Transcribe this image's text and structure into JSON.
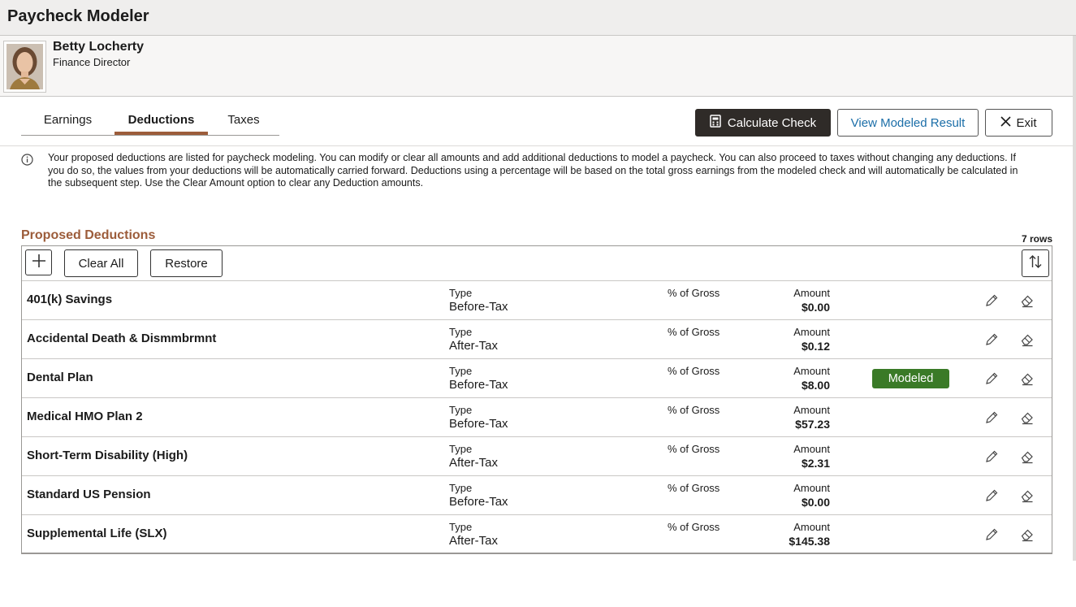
{
  "app": {
    "title": "Paycheck Modeler"
  },
  "employee": {
    "name": "Betty Locherty",
    "title": "Finance Director"
  },
  "tabs": [
    {
      "label": "Earnings"
    },
    {
      "label": "Deductions",
      "selected": true
    },
    {
      "label": "Taxes"
    }
  ],
  "actions": {
    "calculate": "Calculate Check",
    "view_result": "View Modeled Result",
    "exit": "Exit"
  },
  "info": {
    "text": "Your proposed deductions are listed for paycheck modeling. You can modify or clear all amounts and add additional deductions to model a paycheck. You can also proceed to taxes without changing any deductions. If you do so, the values from your deductions will be automatically carried forward. Deductions using a percentage will be based on the total gross earnings from the modeled check and will automatically be calculated in the subsequent step. Use the Clear Amount option to clear any Deduction amounts."
  },
  "grid": {
    "title": "Proposed Deductions",
    "row_count": "7 rows",
    "toolbar": {
      "clear_all": "Clear All",
      "restore": "Restore"
    },
    "labels": {
      "type": "Type",
      "pct": "% of Gross",
      "amount": "Amount"
    },
    "rows": [
      {
        "name": "401(k) Savings",
        "type": "Before-Tax",
        "amount": "$0.00",
        "badge": ""
      },
      {
        "name": "Accidental Death & Dismmbrmnt",
        "type": "After-Tax",
        "amount": "$0.12",
        "badge": ""
      },
      {
        "name": "Dental Plan",
        "type": "Before-Tax",
        "amount": "$8.00",
        "badge": "Modeled"
      },
      {
        "name": "Medical HMO Plan 2",
        "type": "Before-Tax",
        "amount": "$57.23",
        "badge": ""
      },
      {
        "name": "Short-Term Disability (High)",
        "type": "After-Tax",
        "amount": "$2.31",
        "badge": ""
      },
      {
        "name": "Standard US Pension",
        "type": "Before-Tax",
        "amount": "$0.00",
        "badge": ""
      },
      {
        "name": "Supplemental Life (SLX)",
        "type": "After-Tax",
        "amount": "$145.38",
        "badge": ""
      }
    ]
  },
  "icons": {
    "info": "info-circle-icon",
    "calculator": "calculator-icon",
    "close": "close-icon",
    "add": "plus-icon",
    "sort": "sort-icon",
    "edit": "pencil-icon",
    "clear": "eraser-icon"
  },
  "colors": {
    "accent": "#9c5c3a",
    "badge": "#3a7a27",
    "primary_button": "#2f2b28",
    "link": "#1b6ea8"
  }
}
